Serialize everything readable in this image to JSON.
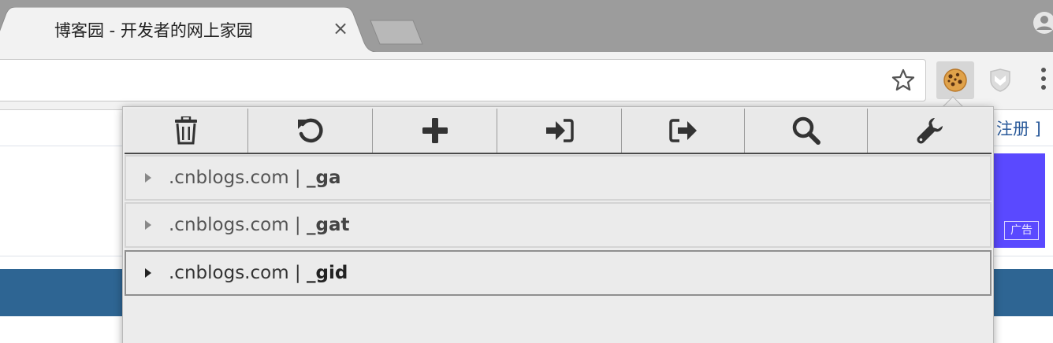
{
  "browser": {
    "tab_title": "博客园 - 开发者的网上家园",
    "tab_close": "×",
    "colors": {
      "tabstrip": "#9c9c9c",
      "toolbar": "#f2f2f2"
    }
  },
  "page": {
    "register_link": "注册 ]",
    "ad_label": "广告",
    "colors": {
      "navbar": "#2e6593",
      "ad": "#5a49ff"
    }
  },
  "popup": {
    "toolbar_buttons": [
      {
        "name": "delete-all",
        "icon": "trash-icon"
      },
      {
        "name": "reset",
        "icon": "undo-icon"
      },
      {
        "name": "add",
        "icon": "plus-icon"
      },
      {
        "name": "import",
        "icon": "sign-in-icon"
      },
      {
        "name": "export",
        "icon": "sign-out-icon"
      },
      {
        "name": "search",
        "icon": "search-icon"
      },
      {
        "name": "options",
        "icon": "wrench-icon"
      }
    ],
    "cookies": [
      {
        "domain": ".cnblogs.com",
        "separator": " | ",
        "name": "_ga"
      },
      {
        "domain": ".cnblogs.com",
        "separator": " | ",
        "name": "_gat"
      },
      {
        "domain": ".cnblogs.com",
        "separator": " | ",
        "name": "_gid"
      }
    ]
  }
}
